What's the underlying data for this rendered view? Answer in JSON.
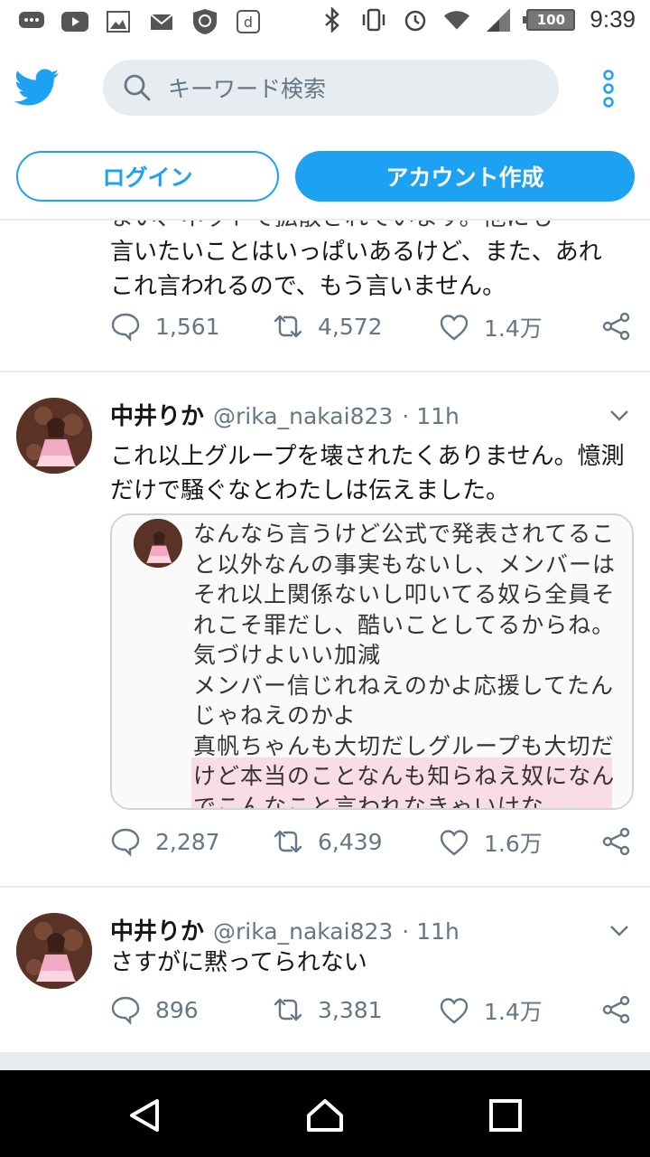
{
  "status_bar": {
    "time": "9:39",
    "battery": "100",
    "left_icons": [
      "chat-bubble-icon",
      "youtube-icon",
      "image-icon",
      "mail-icon",
      "shield-icon",
      "docomo-icon"
    ],
    "right_icons": [
      "bluetooth-icon",
      "vibrate-icon",
      "alarm-icon",
      "wifi-icon",
      "signal-icon"
    ]
  },
  "header": {
    "search_placeholder": "キーワード検索"
  },
  "auth": {
    "login_label": "ログイン",
    "signup_label": "アカウント作成"
  },
  "tweets": [
    {
      "text_partial": "まい、ネットで拡散されています。他にも",
      "text": "言いたいことはいっぱいあるけど、また、あれこれ言われるので、もう言いません。",
      "reply_count": "1,561",
      "retweet_count": "4,572",
      "like_count": "1.4万"
    },
    {
      "name": "中井りか",
      "handle": "@rika_nakai823",
      "time": "· 11h",
      "text": "これ以上グループを壊されたくありません。憶測だけで騒ぐなとわたしは伝えました。",
      "embedded_text": "なんなら言うけど公式で発表されてること以外なんの事実もないし、メンバーはそれ以上関係ないし叩いてる奴ら全員それこそ罪だし、酷いことしてるからね。気づけよいい加減\nメンバー信じれねえのかよ応援してたんじゃねえのかよ\n真帆ちゃんも大切だしグループも大切だけど本当のことなんも知らねえ奴になんでこんなこと言われなきゃいけな",
      "reply_count": "2,287",
      "retweet_count": "6,439",
      "like_count": "1.6万"
    },
    {
      "name": "中井りか",
      "handle": "@rika_nakai823",
      "time": "· 11h",
      "text": "さすがに黙ってられない",
      "reply_count": "896",
      "retweet_count": "3,381",
      "like_count": "1.4万"
    }
  ],
  "colors": {
    "brand": "#1da1f2",
    "secondary_text": "#657786",
    "divider": "#e6ecf0"
  }
}
